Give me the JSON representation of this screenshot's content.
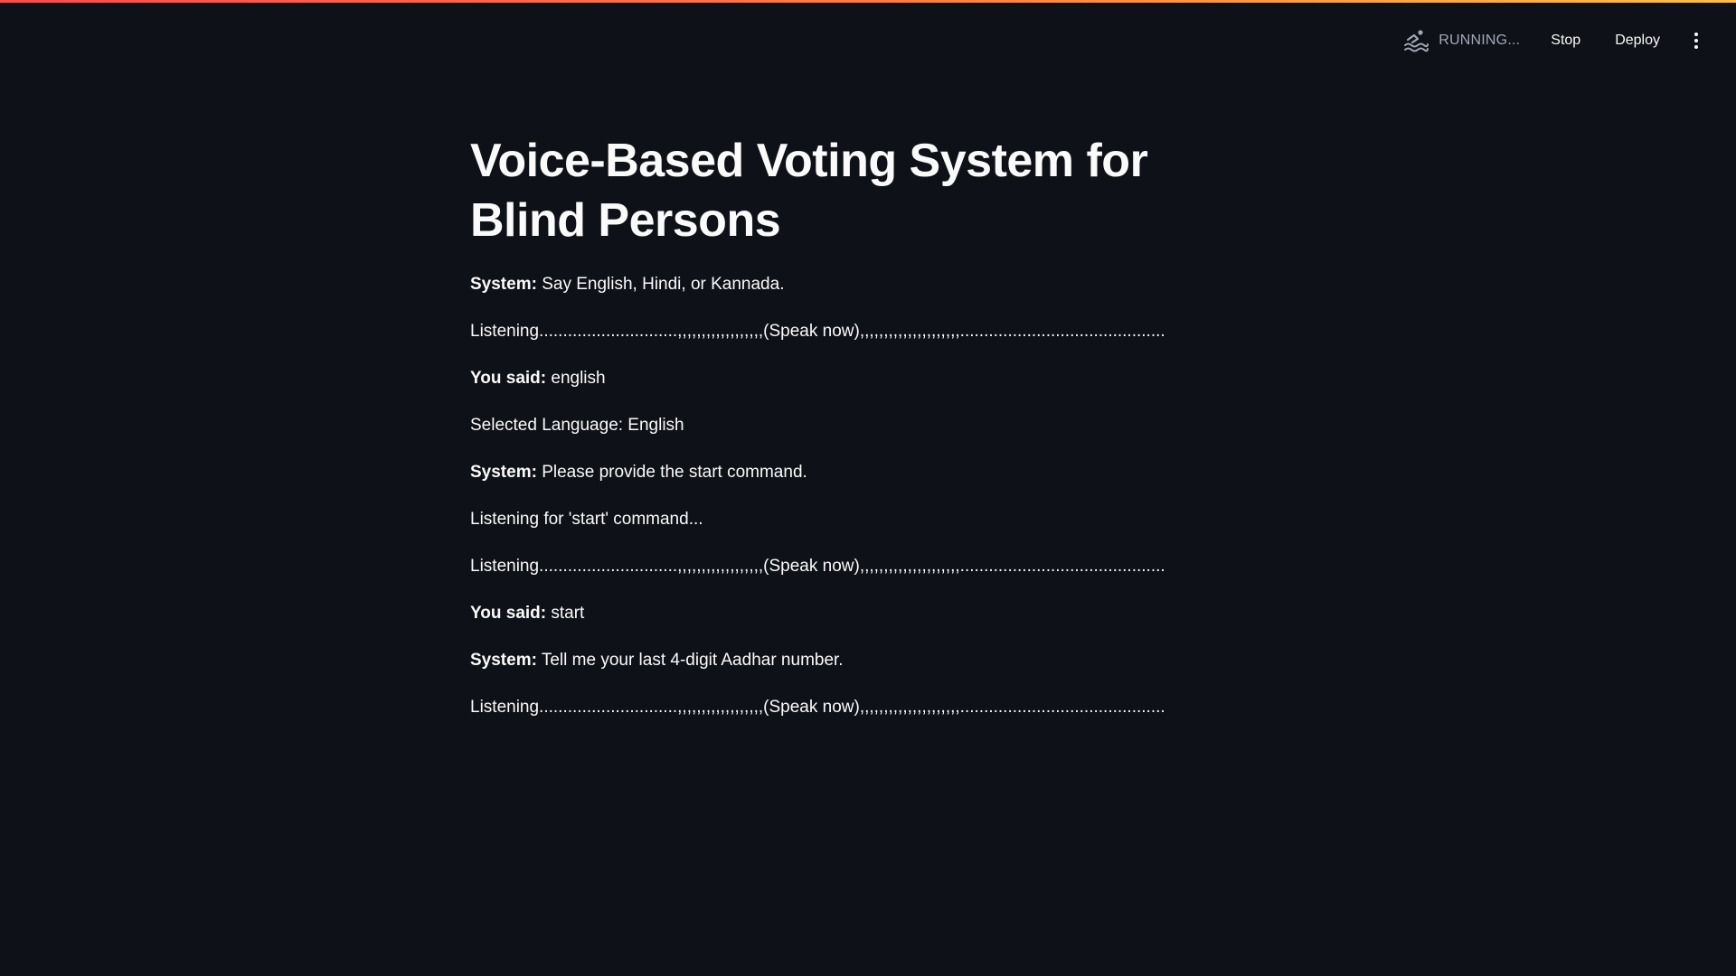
{
  "header": {
    "status_text": "RUNNING...",
    "status_icon": "swimmer-icon",
    "stop_label": "Stop",
    "deploy_label": "Deploy",
    "menu_icon": "more-vertical-icon",
    "accent_gradient": [
      "#ff4b4b",
      "#ffbd45"
    ]
  },
  "main": {
    "title": "Voice-Based Voting System for Blind Persons",
    "messages": [
      {
        "prefix": "System:",
        "text": " Say English, Hindi, or Kannada."
      },
      {
        "prefix": "",
        "text": "Listening.............................,,,,,,,,,,,,,,,,,,(Speak now),,,,,,,,,,,,,,,,,,,,,..........................................."
      },
      {
        "prefix": "You said:",
        "text": " english"
      },
      {
        "prefix": "",
        "text": "Selected Language: English"
      },
      {
        "prefix": "System:",
        "text": " Please provide the start command."
      },
      {
        "prefix": "",
        "text": "Listening for 'start' command..."
      },
      {
        "prefix": "",
        "text": "Listening.............................,,,,,,,,,,,,,,,,,,(Speak now),,,,,,,,,,,,,,,,,,,,,..........................................."
      },
      {
        "prefix": "You said:",
        "text": " start"
      },
      {
        "prefix": "System:",
        "text": " Tell me your last 4-digit Aadhar number."
      },
      {
        "prefix": "",
        "text": "Listening.............................,,,,,,,,,,,,,,,,,,(Speak now),,,,,,,,,,,,,,,,,,,,,..........................................."
      }
    ]
  },
  "colors": {
    "background": "#0e1117",
    "text": "#fafafa",
    "status_text": "#a3a8b8"
  }
}
